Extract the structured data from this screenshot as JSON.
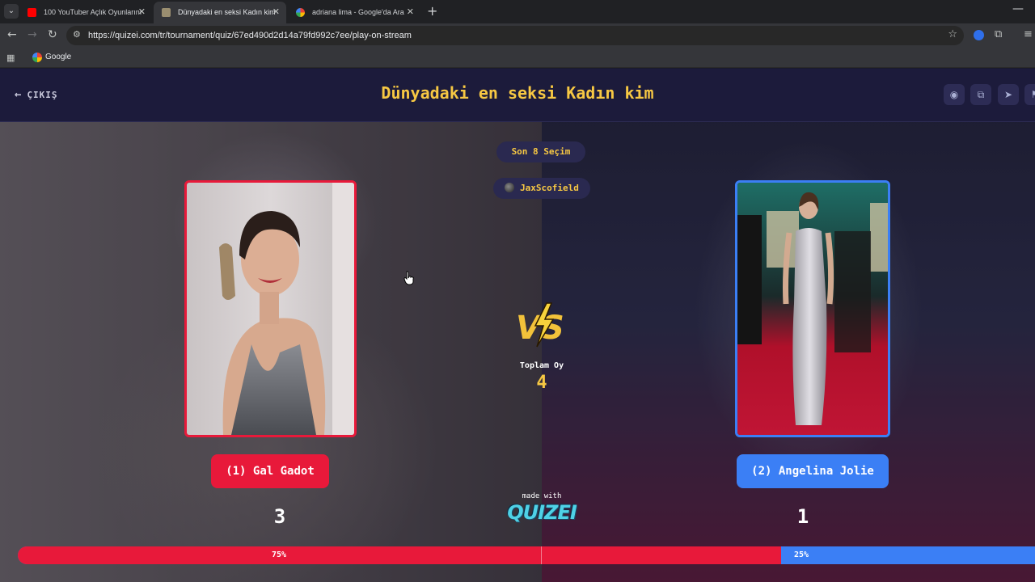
{
  "browser": {
    "tabs": [
      {
        "title": "100 YouTuber Açlık Oyunlarını",
        "favicon_color": "#ff0000"
      },
      {
        "title": "Dünyadaki en seksi Kadın kim",
        "favicon_color": "#9a8e70"
      },
      {
        "title": "adriana lima - Google'da Ara",
        "favicon_color": "#4285f4"
      }
    ],
    "url": "https://quizei.com/tr/tournament/quiz/67ed490d2d14a79fd992c7ee/play-on-stream",
    "bookmark": "Google"
  },
  "header": {
    "exit_label": "ÇIKIŞ",
    "title": "Dünyadaki en seksi Kadın kim"
  },
  "round": {
    "stage_label": "Son 8 Seçim",
    "streamer": "JaxScofield"
  },
  "left_choice": {
    "label": "(1) Gal Gadot",
    "votes": "3",
    "percent_label": "75%",
    "percent": 75,
    "color": "#e8193a"
  },
  "right_choice": {
    "label": "(2) Angelina Jolie",
    "votes": "1",
    "percent_label": "25%",
    "percent": 25,
    "color": "#3b7ff5"
  },
  "center": {
    "total_label": "Toplam Oy",
    "total_votes": "4",
    "made_with": "made with",
    "logo_text": "QUIZEI"
  }
}
